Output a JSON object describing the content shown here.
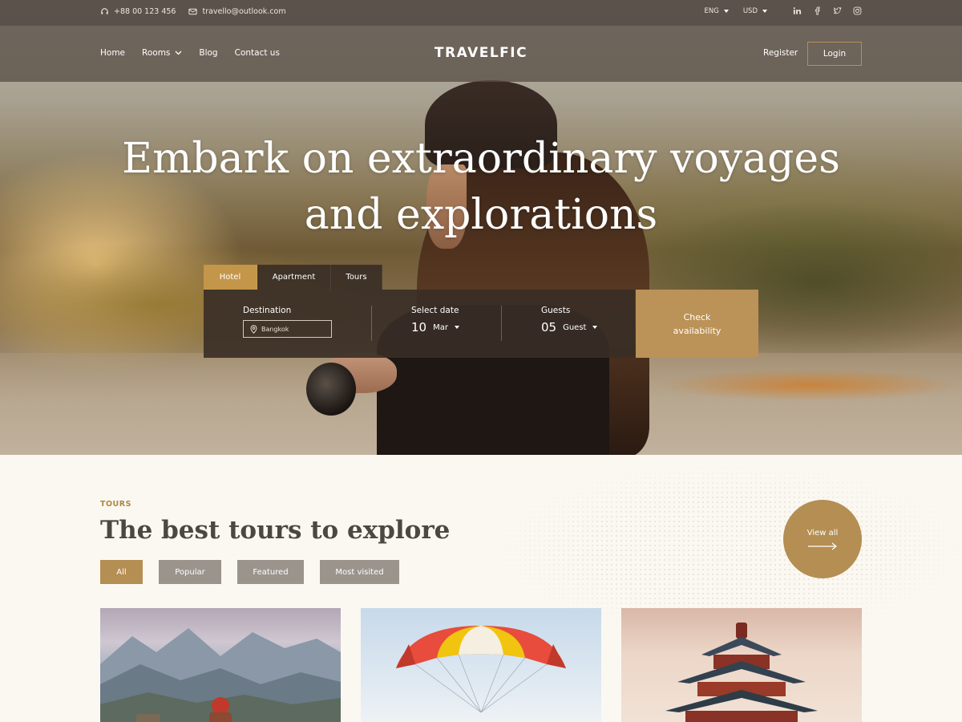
{
  "topbar": {
    "phone": "+88 00 123 456",
    "email": "travello@outlook.com",
    "language": "ENG",
    "currency": "USD",
    "socials": [
      "linkedin-icon",
      "facebook-icon",
      "twitter-icon",
      "instagram-icon"
    ]
  },
  "nav": {
    "links": [
      "Home",
      "Rooms",
      "Blog",
      "Contact us"
    ],
    "logo": "TRAVELFIC",
    "register": "Register",
    "login": "Login"
  },
  "hero": {
    "headline_line1": "Embark on extraordinary voyages",
    "headline_line2": "and explorations"
  },
  "search": {
    "tabs": [
      "Hotel",
      "Apartment",
      "Tours"
    ],
    "active_tab": "Hotel",
    "destination_label": "Destination",
    "destination_value": "Bangkok",
    "date_label": "Select date",
    "date_day": "10",
    "date_month": "Mar",
    "guests_label": "Guests",
    "guests_count": "05",
    "guests_unit": "Guest",
    "check_line1": "Check",
    "check_line2": "availability"
  },
  "tours": {
    "kicker": "TOURS",
    "title": "The best tours to explore",
    "filters": [
      "All",
      "Popular",
      "Featured",
      "Most visited"
    ],
    "active_filter": "All",
    "view_all": "View all"
  },
  "colors": {
    "accent": "#b48e52",
    "tab_active": "#c4964a",
    "page_bg": "#fbf8f2",
    "title_text": "#4d4742"
  }
}
